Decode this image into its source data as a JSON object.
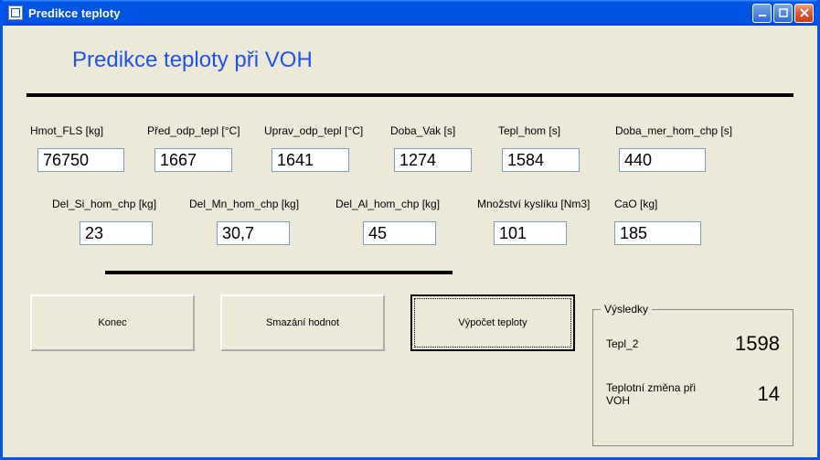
{
  "window": {
    "title": "Predikce teploty"
  },
  "heading": "Predikce  teploty při VOH",
  "row1": {
    "hmot_fls": {
      "label": "Hmot_FLS [kg]",
      "value": "76750"
    },
    "pred_odp_tepl": {
      "label": "Před_odp_tepl [°C]",
      "value": "1667"
    },
    "uprav_odp_tepl": {
      "label": "Uprav_odp_tepl [°C]",
      "value": "1641"
    },
    "doba_vak": {
      "label": "Doba_Vak [s]",
      "value": "1274"
    },
    "tepl_hom": {
      "label": "Tepl_hom [s]",
      "value": "1584"
    },
    "doba_mer_hom_chp": {
      "label": "Doba_mer_hom_chp [s]",
      "value": "440"
    }
  },
  "row2": {
    "del_si": {
      "label": "Del_Si_hom_chp [kg]",
      "value": "23"
    },
    "del_mn": {
      "label": "Del_Mn_hom_chp [kg]",
      "value": "30,7"
    },
    "del_al": {
      "label": "Del_Al_hom_chp [kg]",
      "value": "45"
    },
    "mnozstvi_kysliku": {
      "label": "Množství kyslíku [Nm3]",
      "value": "101"
    },
    "cao": {
      "label": "CaO [kg]",
      "value": "185"
    }
  },
  "buttons": {
    "konec": "Konec",
    "smazani": "Smazání hodnot",
    "vypocet": "Výpočet teploty"
  },
  "results": {
    "legend": "Výsledky",
    "tepl2_label": "Tepl_2",
    "tepl2_value": "1598",
    "tepl_zmena_label": "Teplotní změna při VOH",
    "tepl_zmena_value": "14"
  }
}
